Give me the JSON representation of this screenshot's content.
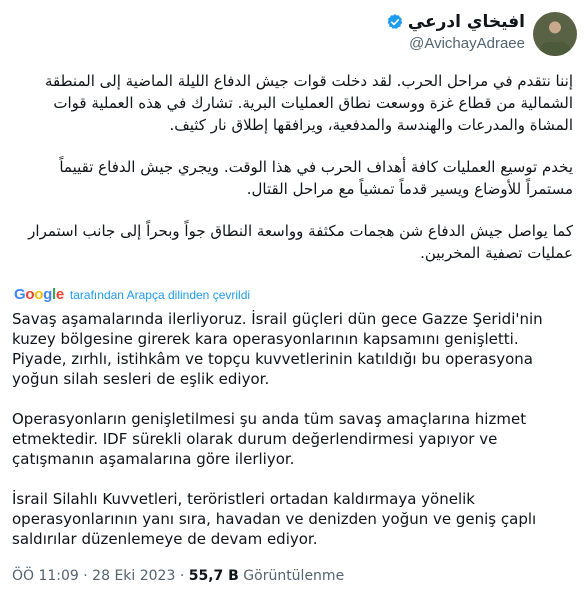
{
  "author": {
    "display_name": "افيخاي ادرعي",
    "handle": "@AvichayAdraee",
    "verified_color": "#1d9bf0"
  },
  "tweet": {
    "original_paragraphs": [
      "إننا نتقدم في مراحل الحرب. لقد دخلت قوات جيش الدفاع الليلة الماضية إلى المنطقة الشمالية من قطاع غزة ووسعت نطاق العمليات البرية. تشارك في هذه العملية قوات المشاة والمدرعات والهندسة والمدفعية، ويرافقها إطلاق نار كثيف.",
      "يخدم توسيع العمليات كافة أهداف الحرب في هذا الوقت. ويجري جيش الدفاع تقييماً مستمراً للأوضاع ويسير قدماً تمشياً مع مراحل القتال.",
      "كما يواصل جيش الدفاع شن هجمات مكثفة وواسعة النطاق جواً وبحراً إلى جانب استمرار عمليات تصفية المخربين."
    ],
    "translation": {
      "provider": "Google",
      "label": "tarafından Arapça dilinden çevrildi",
      "paragraphs": [
        "Savaş aşamalarında ilerliyoruz. İsrail güçleri dün gece Gazze Şeridi'nin kuzey bölgesine girerek kara operasyonlarının kapsamını genişletti. Piyade, zırhlı, istihkâm ve topçu kuvvetlerinin katıldığı bu operasyona yoğun silah sesleri de eşlik ediyor.",
        "Operasyonların genişletilmesi şu anda tüm savaş amaçlarına hizmet etmektedir. IDF sürekli olarak durum değerlendirmesi yapıyor ve çatışmanın aşamalarına göre ilerliyor.",
        "İsrail Silahlı Kuvvetleri, teröristleri ortadan kaldırmaya yönelik operasyonlarının yanı sıra, havadan ve denizden yoğun ve geniş çaplı saldırılar düzenlemeye de devam ediyor."
      ]
    },
    "timestamp": "ÖÖ 11:09 · 28 Eki 2023 · ",
    "views_count": "55,7 B",
    "views_label": " Görüntülenme"
  }
}
